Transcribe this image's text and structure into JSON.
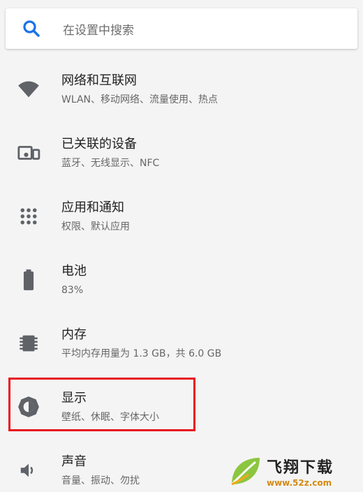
{
  "search": {
    "placeholder": "在设置中搜索"
  },
  "items": [
    {
      "title": "网络和互联网",
      "sub": "WLAN、移动网络、流量使用、热点",
      "icon": "wifi-icon"
    },
    {
      "title": "已关联的设备",
      "sub": "蓝牙、无线显示、NFC",
      "icon": "devices-icon"
    },
    {
      "title": "应用和通知",
      "sub": "权限、默认应用",
      "icon": "apps-icon"
    },
    {
      "title": "电池",
      "sub": "83%",
      "icon": "battery-icon"
    },
    {
      "title": "内存",
      "sub": "平均内存用量为 1.3 GB，共 6.0 GB",
      "icon": "memory-icon"
    },
    {
      "title": "显示",
      "sub": "壁纸、休眠、字体大小",
      "icon": "brightness-icon"
    },
    {
      "title": "声音",
      "sub": "音量、振动、勿扰",
      "icon": "volume-icon"
    }
  ],
  "colors": {
    "accent": "#1a73e8",
    "icon": "#5f6368",
    "highlight": "#e8141d"
  },
  "watermark": {
    "name": "飞翔下载",
    "url": "www.52z.com"
  }
}
